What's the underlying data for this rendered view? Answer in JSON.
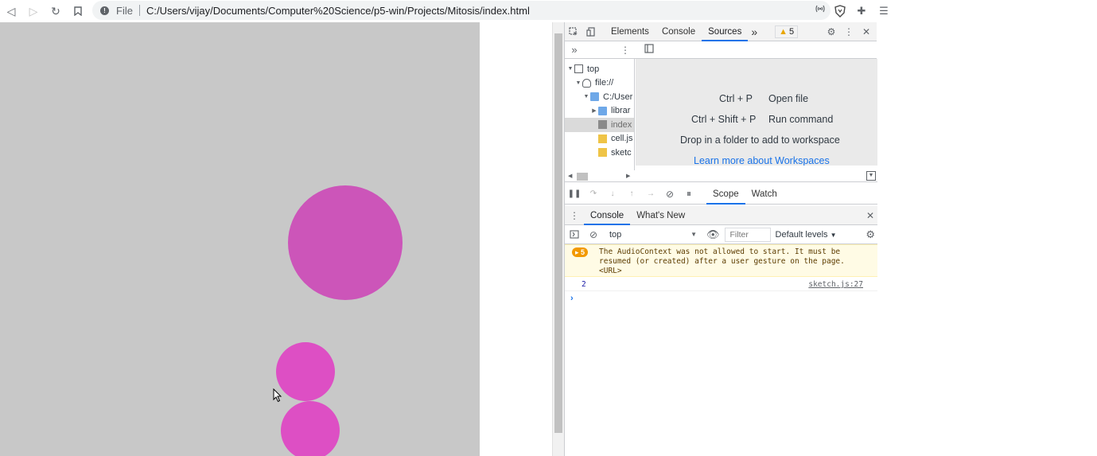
{
  "browser": {
    "scheme_label": "File",
    "url": "C:/Users/vijay/Documents/Computer%20Science/p5-win/Projects/Mitosis/index.html"
  },
  "colors": {
    "canvas_bg": "#c8c8c8",
    "cell_large": "#cc55b9",
    "cell_small_a": "#dd4fc4",
    "cell_small_b": "#dd4fc4",
    "accent": "#1a73e8",
    "warning": "#f29900"
  },
  "devtools": {
    "tabs": [
      {
        "label": "Elements"
      },
      {
        "label": "Console"
      },
      {
        "label": "Sources"
      }
    ],
    "more_tabs": "»",
    "warning_count": "5",
    "navigator": {
      "more": "»",
      "items": [
        {
          "label": "top"
        },
        {
          "label": "file://"
        },
        {
          "label": "C:/User"
        },
        {
          "label": "librar"
        },
        {
          "label": "index"
        },
        {
          "label": "cell.js"
        },
        {
          "label": "sketc"
        }
      ]
    },
    "editor": {
      "shortcut_open_keys": "Ctrl + P",
      "shortcut_open_label": "Open file",
      "shortcut_run_keys": "Ctrl + Shift + P",
      "shortcut_run_label": "Run command",
      "drop_text": "Drop in a folder to add to workspace",
      "learn_link": "Learn more about Workspaces"
    },
    "debugger": {
      "scope_tab": "Scope",
      "watch_tab": "Watch"
    },
    "drawer": {
      "console_tab": "Console",
      "whats_new_tab": "What's New",
      "context": "top",
      "filter_placeholder": "Filter",
      "levels": "Default levels"
    },
    "messages": {
      "warning_count": "5",
      "warning_text": "The AudioContext was not allowed to start. It must be resumed (or created) after a user gesture on the page. <URL>",
      "log_value": "2",
      "log_source": "sketch.js:27",
      "prompt": "›"
    }
  }
}
